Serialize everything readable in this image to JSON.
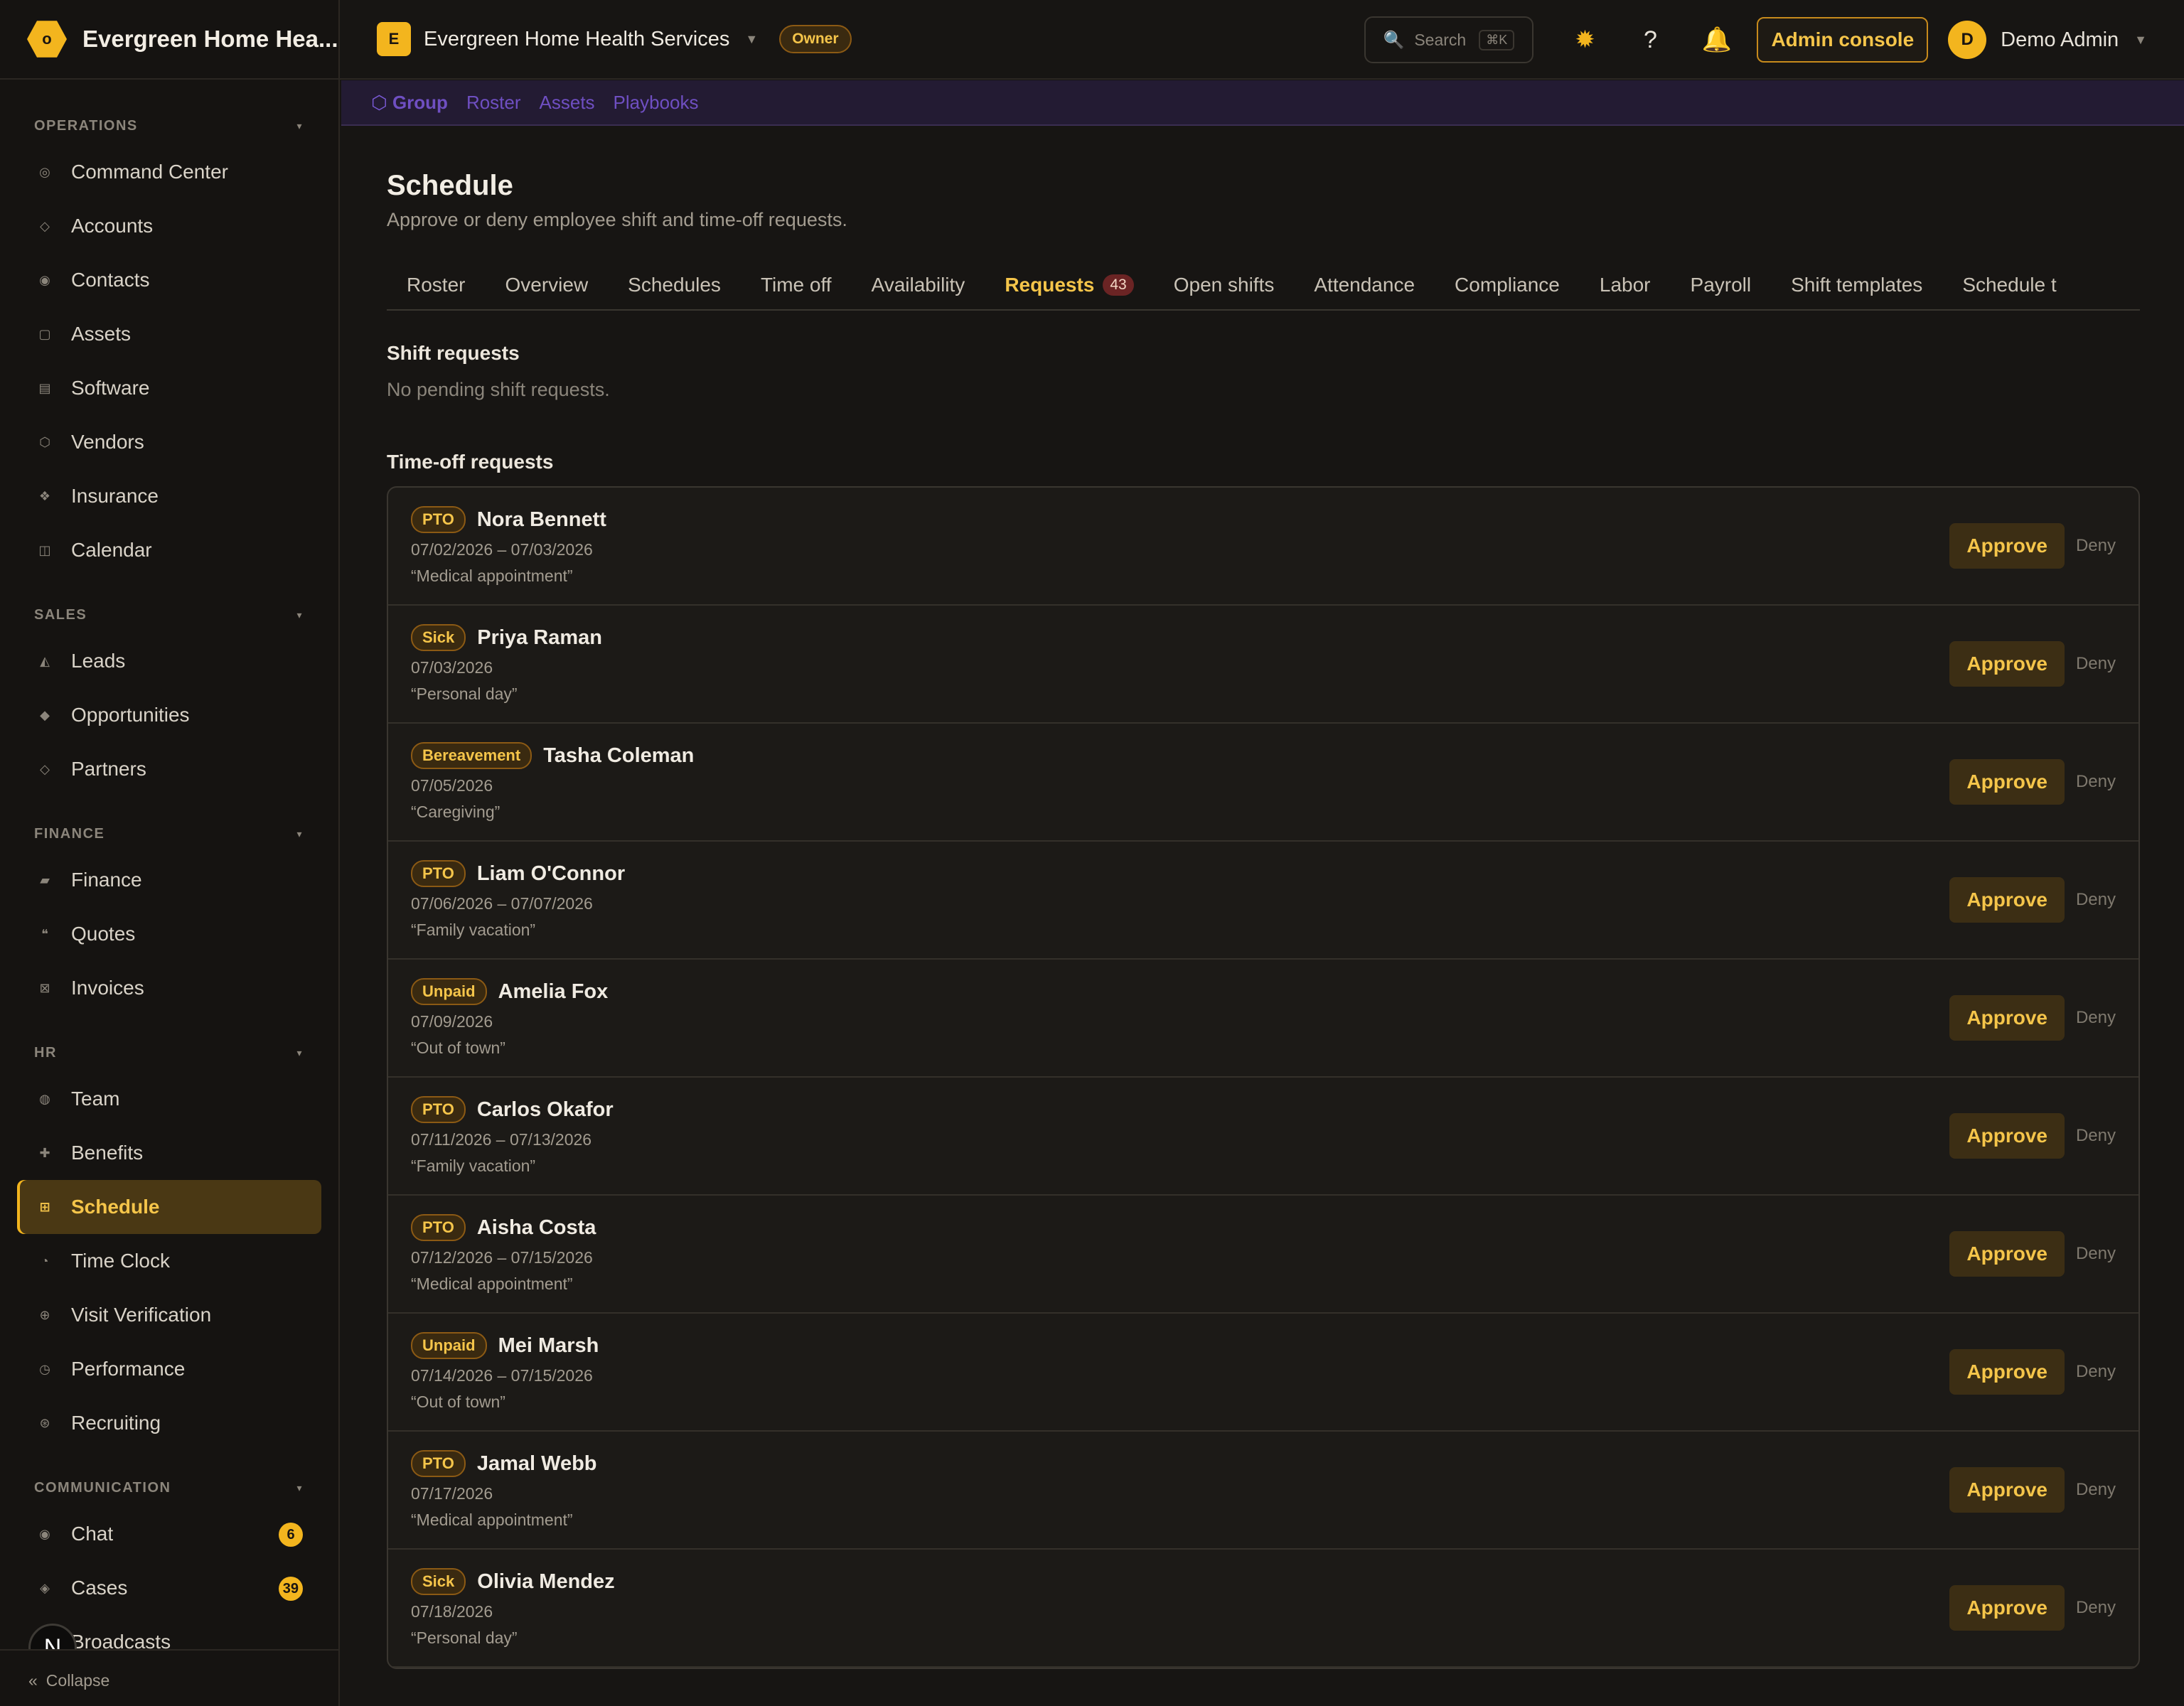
{
  "brand": {
    "name": "Evergreen Home Hea...",
    "logo_letter": "o"
  },
  "sidebar": {
    "sections": [
      {
        "title": "OPERATIONS",
        "items": [
          {
            "label": "Command Center",
            "icon": "◎"
          },
          {
            "label": "Accounts",
            "icon": "◇"
          },
          {
            "label": "Contacts",
            "icon": "◉"
          },
          {
            "label": "Assets",
            "icon": "▢"
          },
          {
            "label": "Software",
            "icon": "▤"
          },
          {
            "label": "Vendors",
            "icon": "⬡"
          },
          {
            "label": "Insurance",
            "icon": "❖"
          },
          {
            "label": "Calendar",
            "icon": "◫"
          }
        ]
      },
      {
        "title": "SALES",
        "items": [
          {
            "label": "Leads",
            "icon": "◭"
          },
          {
            "label": "Opportunities",
            "icon": "◆"
          },
          {
            "label": "Partners",
            "icon": "◇"
          }
        ]
      },
      {
        "title": "FINANCE",
        "items": [
          {
            "label": "Finance",
            "icon": "▰"
          },
          {
            "label": "Quotes",
            "icon": "❝"
          },
          {
            "label": "Invoices",
            "icon": "⊠"
          }
        ]
      },
      {
        "title": "HR",
        "items": [
          {
            "label": "Team",
            "icon": "◍"
          },
          {
            "label": "Benefits",
            "icon": "✚"
          },
          {
            "label": "Schedule",
            "icon": "⊞",
            "active": true
          },
          {
            "label": "Time Clock",
            "icon": "◔"
          },
          {
            "label": "Visit Verification",
            "icon": "⊕"
          },
          {
            "label": "Performance",
            "icon": "◷"
          },
          {
            "label": "Recruiting",
            "icon": "⊛"
          }
        ]
      },
      {
        "title": "COMMUNICATION",
        "items": [
          {
            "label": "Chat",
            "icon": "◉",
            "badge": "6"
          },
          {
            "label": "Cases",
            "icon": "◈",
            "badge": "39"
          },
          {
            "label": "Broadcasts",
            "icon": "◌"
          }
        ]
      }
    ],
    "collapse_label": "Collapse",
    "floating_avatar": "N"
  },
  "topbar": {
    "org_letter": "E",
    "org_name": "Evergreen Home Health Services",
    "role_badge": "Owner",
    "search_placeholder": "Search",
    "search_shortcut": "⌘K",
    "admin_console_label": "Admin console",
    "user_initial": "D",
    "user_name": "Demo Admin"
  },
  "subbar": {
    "links": [
      "Group",
      "Roster",
      "Assets",
      "Playbooks"
    ]
  },
  "page": {
    "title": "Schedule",
    "subtitle": "Approve or deny employee shift and time-off requests."
  },
  "tabs": [
    {
      "label": "Roster"
    },
    {
      "label": "Overview"
    },
    {
      "label": "Schedules"
    },
    {
      "label": "Time off"
    },
    {
      "label": "Availability"
    },
    {
      "label": "Requests",
      "count": "43",
      "active": true
    },
    {
      "label": "Open shifts"
    },
    {
      "label": "Attendance"
    },
    {
      "label": "Compliance"
    },
    {
      "label": "Labor"
    },
    {
      "label": "Payroll"
    },
    {
      "label": "Shift templates"
    },
    {
      "label": "Schedule t"
    }
  ],
  "shift_requests": {
    "title": "Shift requests",
    "empty_text": "No pending shift requests."
  },
  "time_off": {
    "title": "Time-off requests",
    "approve_label": "Approve",
    "deny_label": "Deny",
    "requests": [
      {
        "type": "PTO",
        "name": "Nora Bennett",
        "dates": "07/02/2026 – 07/03/2026",
        "reason": "“Medical appointment”"
      },
      {
        "type": "Sick",
        "name": "Priya Raman",
        "dates": "07/03/2026",
        "reason": "“Personal day”"
      },
      {
        "type": "Bereavement",
        "name": "Tasha Coleman",
        "dates": "07/05/2026",
        "reason": "“Caregiving”"
      },
      {
        "type": "PTO",
        "name": "Liam O'Connor",
        "dates": "07/06/2026 – 07/07/2026",
        "reason": "“Family vacation”"
      },
      {
        "type": "Unpaid",
        "name": "Amelia Fox",
        "dates": "07/09/2026",
        "reason": "“Out of town”"
      },
      {
        "type": "PTO",
        "name": "Carlos Okafor",
        "dates": "07/11/2026 – 07/13/2026",
        "reason": "“Family vacation”"
      },
      {
        "type": "PTO",
        "name": "Aisha Costa",
        "dates": "07/12/2026 – 07/15/2026",
        "reason": "“Medical appointment”"
      },
      {
        "type": "Unpaid",
        "name": "Mei Marsh",
        "dates": "07/14/2026 – 07/15/2026",
        "reason": "“Out of town”"
      },
      {
        "type": "PTO",
        "name": "Jamal Webb",
        "dates": "07/17/2026",
        "reason": "“Medical appointment”"
      },
      {
        "type": "Sick",
        "name": "Olivia Mendez",
        "dates": "07/18/2026",
        "reason": "“Personal day”"
      }
    ]
  }
}
